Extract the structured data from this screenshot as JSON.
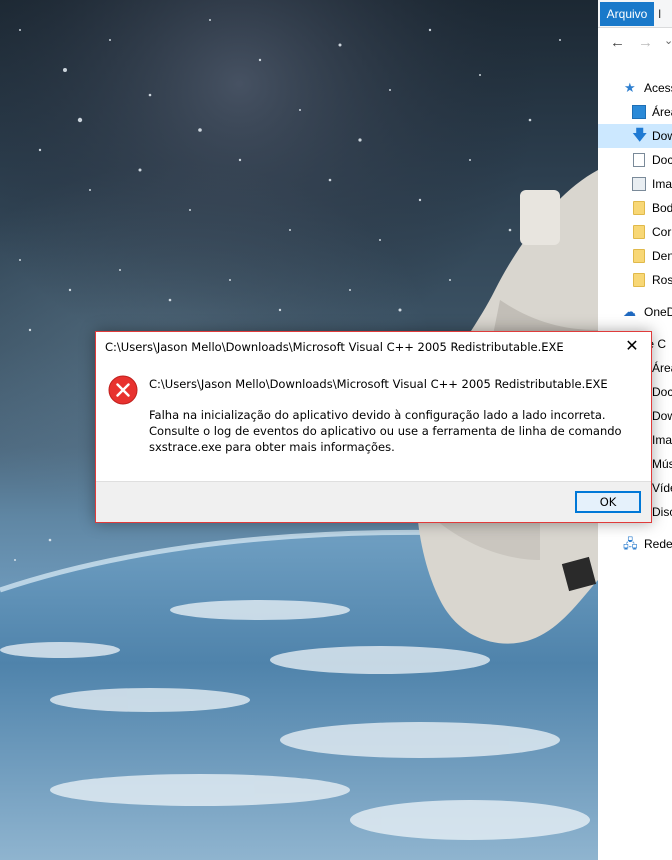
{
  "explorer": {
    "ribbon_tab": "Arquivo",
    "ribbon_next_tab": "I",
    "nav": {
      "back": "←",
      "forward": "→",
      "recent": "⌄"
    },
    "tree": [
      {
        "label": "Acess",
        "icon": "star-icon"
      },
      {
        "label": "Área",
        "icon": "desktop-icon"
      },
      {
        "label": "Dow",
        "icon": "download-icon",
        "selected": true
      },
      {
        "label": "Doc",
        "icon": "document-icon"
      },
      {
        "label": "Ima",
        "icon": "image-icon"
      },
      {
        "label": "Bod",
        "icon": "folder-icon"
      },
      {
        "label": "Cor",
        "icon": "folder-icon"
      },
      {
        "label": "Den",
        "icon": "folder-icon"
      },
      {
        "label": "Ros",
        "icon": "folder-icon"
      },
      {
        "label": "OneD",
        "icon": "cloud-icon"
      },
      {
        "label": "ste C",
        "icon": "none"
      },
      {
        "label": "Área",
        "icon": "none"
      },
      {
        "label": "Doc",
        "icon": "none"
      },
      {
        "label": "Dow",
        "icon": "none"
      },
      {
        "label": "Ima",
        "icon": "none"
      },
      {
        "label": "Músi",
        "icon": "none"
      },
      {
        "label": "Víde",
        "icon": "none"
      },
      {
        "label": "Disc",
        "icon": "none"
      },
      {
        "label": "Rede",
        "icon": "network-icon"
      }
    ]
  },
  "dialog": {
    "title": "C:\\Users\\Jason Mello\\Downloads\\Microsoft Visual C++ 2005 Redistributable.EXE",
    "close_glyph": "✕",
    "path": "C:\\Users\\Jason Mello\\Downloads\\Microsoft Visual C++ 2005 Redistributable.EXE",
    "message": "Falha na inicialização do aplicativo devido à configuração lado a lado incorreta. Consulte o log de eventos do aplicativo ou use a ferramenta de linha de comando sxstrace.exe para obter mais informações.",
    "ok_label": "OK",
    "icon": "error-icon",
    "accent_color": "#e03b3b",
    "button_border_color": "#0078d7"
  }
}
